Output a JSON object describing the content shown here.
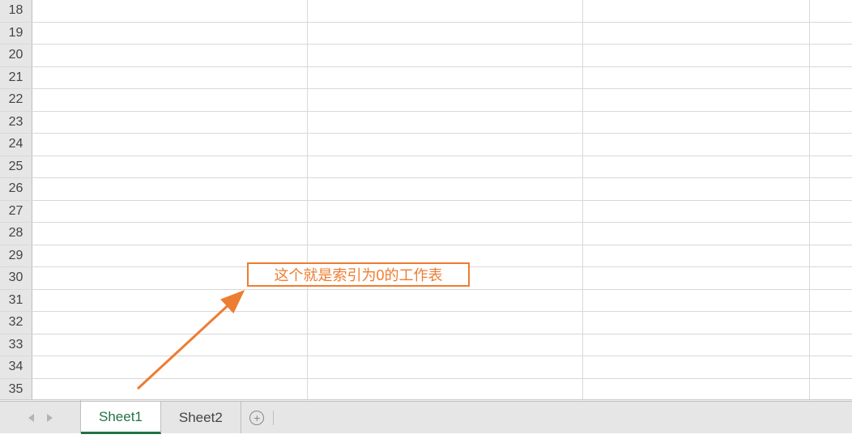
{
  "rows": {
    "start": 18,
    "end": 35,
    "headers": [
      "18",
      "19",
      "20",
      "21",
      "22",
      "23",
      "24",
      "25",
      "26",
      "27",
      "28",
      "29",
      "30",
      "31",
      "32",
      "33",
      "34",
      "35"
    ]
  },
  "annotation": {
    "text": "这个就是索引为0的工作表",
    "color": "#ed7d31"
  },
  "tabs": {
    "items": [
      {
        "label": "Sheet1",
        "active": true
      },
      {
        "label": "Sheet2",
        "active": false
      }
    ],
    "addIcon": "plus-circle-icon"
  }
}
